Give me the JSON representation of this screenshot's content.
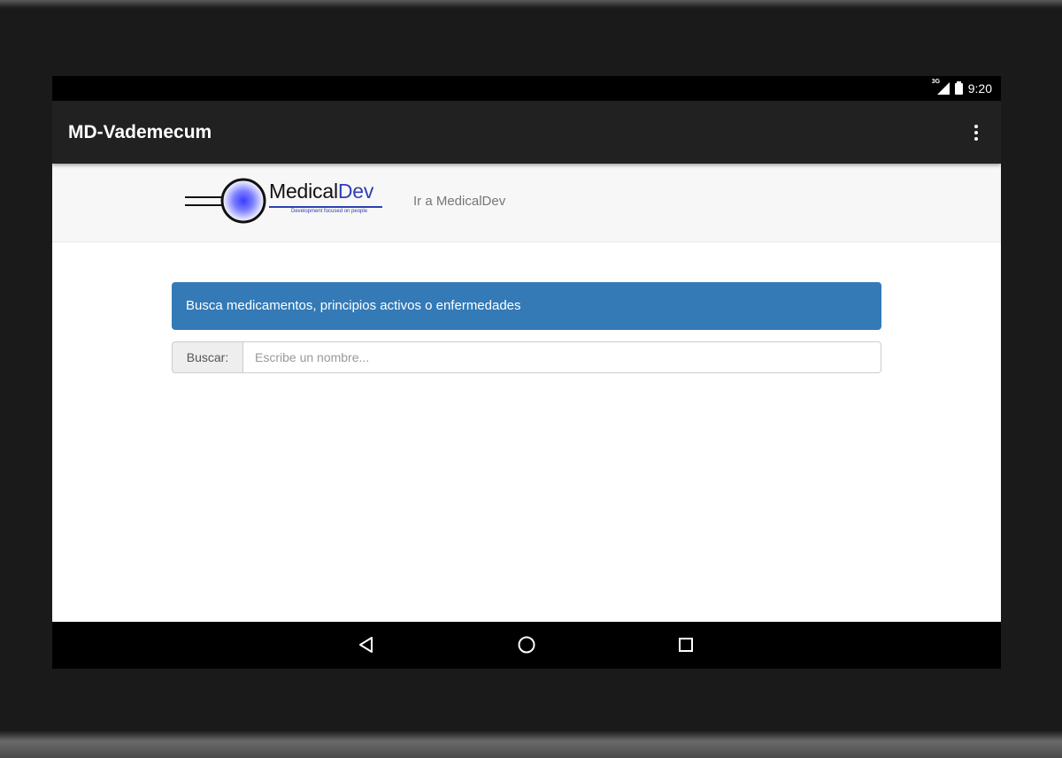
{
  "status_bar": {
    "network": "3G",
    "time": "9:20"
  },
  "app_bar": {
    "title": "MD-Vademecum",
    "menu_icon": "overflow-menu-icon"
  },
  "web_header": {
    "logo": {
      "name_part1": "Medical",
      "name_part2": "Dev",
      "tagline": "Development focused on people"
    },
    "nav_link": "Ir a MedicalDev"
  },
  "info_panel": {
    "text": "Busca medicamentos, principios activos o enfermedades"
  },
  "search": {
    "label": "Buscar:",
    "placeholder": "Escribe un nombre...",
    "value": ""
  },
  "nav_bar": {
    "back_icon": "back-triangle-icon",
    "home_icon": "home-circle-icon",
    "recents_icon": "recents-square-icon"
  },
  "colors": {
    "app_bar": "#212121",
    "panel_primary": "#337ab7",
    "logo_accent": "#2f3fb5"
  }
}
